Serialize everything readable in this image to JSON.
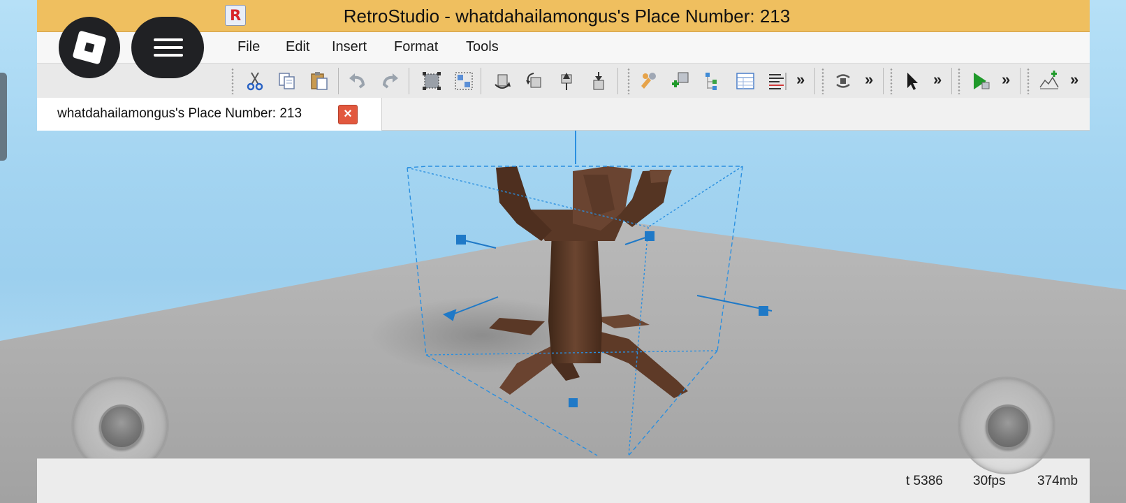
{
  "window": {
    "title": "RetroStudio - whatdahailamongus's Place Number: 213",
    "app_icon_letter": "R"
  },
  "menu": {
    "items": [
      "File",
      "Edit",
      "Insert",
      "Format",
      "Tools"
    ]
  },
  "toolbar": {
    "groups": [
      [
        "cut-icon",
        "copy-icon",
        "paste-icon"
      ],
      [
        "undo-icon",
        "redo-icon"
      ],
      [
        "group-icon",
        "ungroup-icon"
      ],
      [
        "rotate-y-icon",
        "tilt-z-icon",
        "lift-icon",
        "drop-icon"
      ],
      [
        "toolbox-icon",
        "insert-model-icon",
        "explorer-icon",
        "properties-icon",
        "output-icon"
      ],
      [
        "camera-reset-icon"
      ],
      [
        "select-arrow-icon"
      ],
      [
        "play-icon"
      ],
      [
        "terrain-icon"
      ]
    ],
    "overflow_label": "»"
  },
  "tabs": {
    "document_label": "whatdahailamongus's Place Number: 213",
    "close_label": "×"
  },
  "status": {
    "tick": "t 5386",
    "fps": "30fps",
    "memory": "374mb"
  },
  "colors": {
    "titlebar": "#efbf5f",
    "selection_box": "#2a8fe0",
    "trunk": "#5c3a26",
    "baseplate": "#a7a7a7",
    "close_button": "#e2583e"
  }
}
